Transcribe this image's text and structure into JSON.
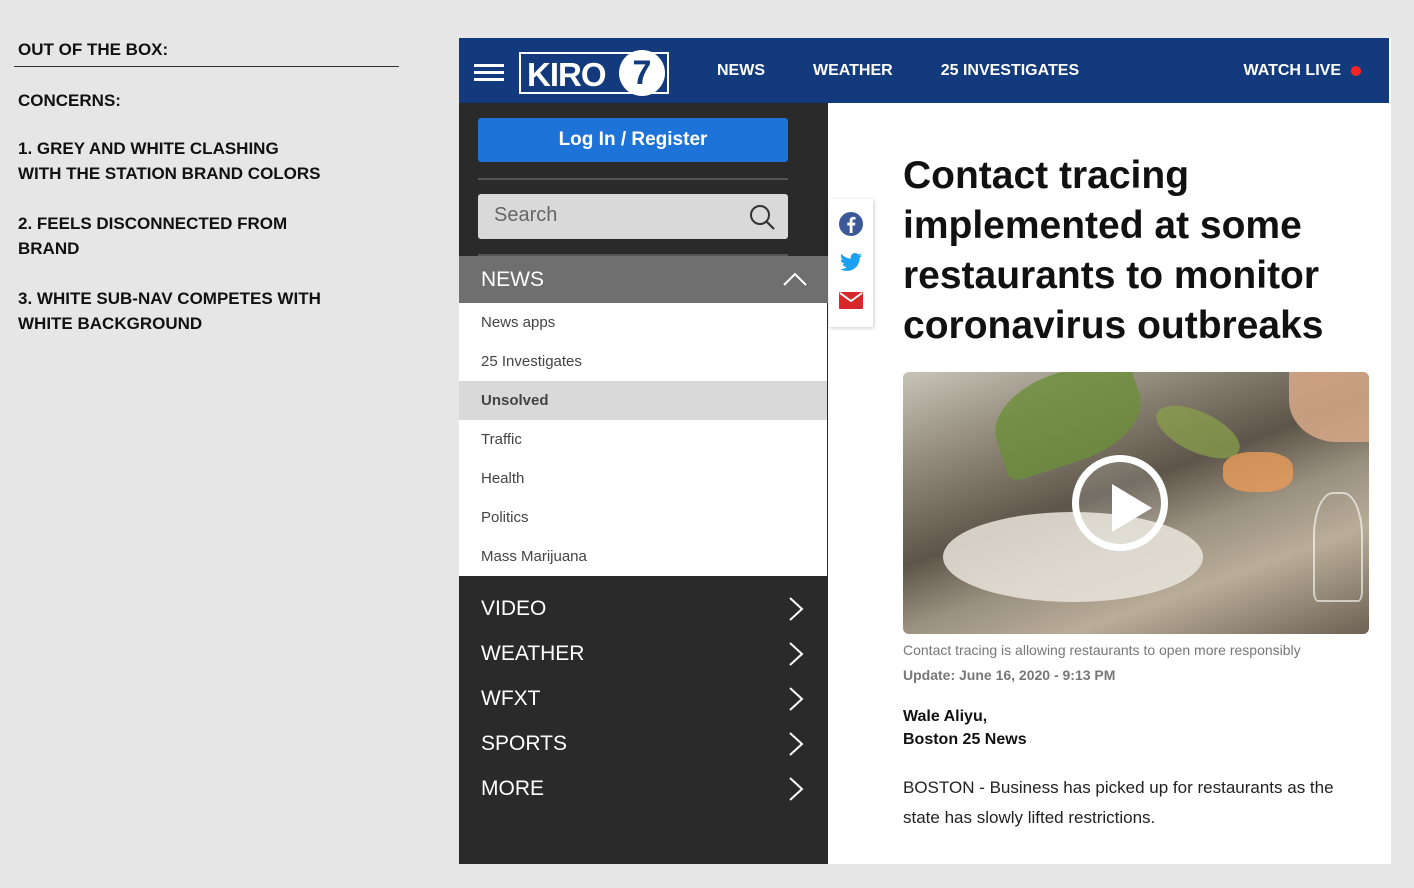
{
  "notes": {
    "title": "OUT OF THE BOX:",
    "concerns_label": "CONCERNS:",
    "items": [
      "1. GREY AND WHITE CLASHING\nWITH THE STATION BRAND COLORS",
      "2. FEELS DISCONNECTED FROM\nBRAND",
      "3. WHITE SUB-NAV COMPETES WITH\nWHITE BACKGROUND"
    ]
  },
  "header": {
    "logo_text": "KIRO",
    "logo_number": "7",
    "nav": [
      "NEWS",
      "WEATHER",
      "25 INVESTIGATES"
    ],
    "watch_live": "WATCH LIVE",
    "brand_color": "#123a7c",
    "live_dot_color": "#ff2525"
  },
  "sidebar": {
    "login_label": "Log In / Register",
    "search_placeholder": "Search",
    "section_title": "NEWS",
    "subitems": [
      "News apps",
      "25 Investigates",
      "Unsolved",
      "Traffic",
      "Health",
      "Politics",
      "Mass Marijuana"
    ],
    "active_subitem": "Unsolved",
    "menu": [
      "VIDEO",
      "WEATHER",
      "WFXT",
      "SPORTS",
      "MORE"
    ]
  },
  "share": {
    "icons": [
      "facebook-icon",
      "twitter-icon",
      "email-icon"
    ]
  },
  "article": {
    "headline": "Contact tracing implemented at some restaurants to monitor coronavirus outbreaks",
    "caption": "Contact tracing is allowing restaurants to open more responsibly",
    "update": "Update: June 16, 2020 - 9:13 PM",
    "author": "Wale Aliyu,",
    "outlet": "Boston 25 News",
    "body": "BOSTON - Business has picked up for restaurants as the state has slowly lifted restrictions."
  }
}
